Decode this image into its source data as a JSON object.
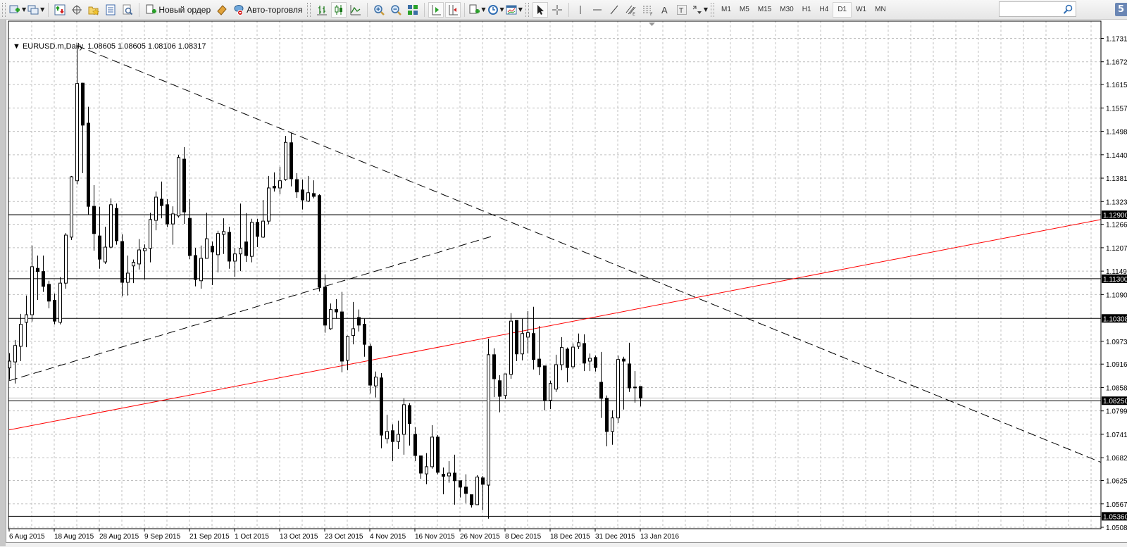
{
  "toolbar": {
    "new_order_label": "Новый ордер",
    "autotrading_label": "Авто-торговля",
    "timeframes": [
      "M1",
      "M5",
      "M15",
      "M30",
      "H1",
      "H4",
      "D1",
      "W1",
      "MN"
    ],
    "active_timeframe": "D1",
    "search_placeholder": "",
    "notification_count": "5"
  },
  "legend": {
    "symbol": "EURUSD.m,Daily",
    "open": "1.08605",
    "high": "1.08605",
    "low": "1.08106",
    "close": "1.08317"
  },
  "colors": {
    "bull_fill": "#ffffff",
    "bear_fill": "#000000",
    "candle_outline": "#000000",
    "grid": "#c0c0c0",
    "trendline_red": "#ff0000",
    "trendline_dashed": "#000000",
    "bid_line": "#c0c0c0"
  },
  "chart_data": {
    "type": "candlestick",
    "symbol": "EURUSD.m",
    "timeframe": "Daily",
    "ylim": [
      1.05085,
      1.1731
    ],
    "price_ticks": [
      "1.17310",
      "1.16725",
      "1.16155",
      "1.15570",
      "1.14985",
      "1.14400",
      "1.13815",
      "1.13230",
      "1.12660",
      "1.12075",
      "1.11490",
      "1.10905",
      "1.09735",
      "1.09165",
      "1.08580",
      "1.07995",
      "1.07410",
      "1.06825",
      "1.06255",
      "1.05670",
      "1.05085"
    ],
    "date_labels": [
      {
        "bar": 0,
        "label": "6 Aug 2015"
      },
      {
        "bar": 8,
        "label": "18 Aug 2015"
      },
      {
        "bar": 16,
        "label": "28 Aug 2015"
      },
      {
        "bar": 24,
        "label": "9 Sep 2015"
      },
      {
        "bar": 32,
        "label": "21 Sep 2015"
      },
      {
        "bar": 40,
        "label": "1 Oct 2015"
      },
      {
        "bar": 48,
        "label": "13 Oct 2015"
      },
      {
        "bar": 56,
        "label": "23 Oct 2015"
      },
      {
        "bar": 64,
        "label": "4 Nov 2015"
      },
      {
        "bar": 72,
        "label": "16 Nov 2015"
      },
      {
        "bar": 80,
        "label": "26 Nov 2015"
      },
      {
        "bar": 88,
        "label": "8 Dec 2015"
      },
      {
        "bar": 96,
        "label": "18 Dec 2015"
      },
      {
        "bar": 104,
        "label": "31 Dec 2015"
      },
      {
        "bar": 112,
        "label": "13 Jan 2016"
      }
    ],
    "horizontal_levels": [
      "1.12900",
      "1.11300",
      "1.10308",
      "1.08250",
      "1.05360"
    ],
    "bid": 1.08317,
    "trendlines": [
      {
        "name": "descending-dashed",
        "style": "dashed",
        "color": "#000000",
        "p1": {
          "bar": 12,
          "price": 1.1713
        },
        "p2": {
          "bar": 193.75,
          "price": 1.0671
        }
      },
      {
        "name": "ascending-dashed",
        "style": "dashed",
        "color": "#000000",
        "p1": {
          "bar": 0,
          "price": 1.0875
        },
        "p2": {
          "bar": 85.9,
          "price": 1.1237
        }
      },
      {
        "name": "ascending-red",
        "style": "solid",
        "color": "#ff0000",
        "p1": {
          "bar": 0,
          "price": 1.0752
        },
        "p2": {
          "bar": 193.75,
          "price": 1.1278
        }
      }
    ],
    "ohlc": [
      [
        1.0907,
        1.0944,
        1.0877,
        1.0924
      ],
      [
        1.0922,
        1.0977,
        1.0868,
        1.0963
      ],
      [
        1.0961,
        1.1042,
        1.0924,
        1.1016
      ],
      [
        1.1021,
        1.1088,
        1.0959,
        1.104
      ],
      [
        1.104,
        1.1213,
        1.1023,
        1.116
      ],
      [
        1.1156,
        1.1188,
        1.1077,
        1.1148
      ],
      [
        1.1148,
        1.1188,
        1.1097,
        1.1111
      ],
      [
        1.1116,
        1.1125,
        1.1056,
        1.1074
      ],
      [
        1.1076,
        1.1093,
        1.1016,
        1.1024
      ],
      [
        1.1021,
        1.1134,
        1.1016,
        1.1119
      ],
      [
        1.1119,
        1.1244,
        1.1105,
        1.1239
      ],
      [
        1.1234,
        1.1387,
        1.1227,
        1.1385
      ],
      [
        1.1375,
        1.1713,
        1.1366,
        1.1618
      ],
      [
        1.1619,
        1.162,
        1.1394,
        1.1514
      ],
      [
        1.1519,
        1.156,
        1.129,
        1.1311
      ],
      [
        1.1311,
        1.1364,
        1.12,
        1.1243
      ],
      [
        1.1237,
        1.131,
        1.1155,
        1.1179
      ],
      [
        1.1172,
        1.126,
        1.1167,
        1.1209
      ],
      [
        1.1209,
        1.1331,
        1.1206,
        1.1315
      ],
      [
        1.1306,
        1.1318,
        1.1215,
        1.1225
      ],
      [
        1.1223,
        1.1241,
        1.1086,
        1.1121
      ],
      [
        1.1121,
        1.1188,
        1.1088,
        1.1144
      ],
      [
        1.1162,
        1.1178,
        1.1119,
        1.1171
      ],
      [
        1.1167,
        1.1229,
        1.1153,
        1.1202
      ],
      [
        1.12,
        1.1216,
        1.1128,
        1.1206
      ],
      [
        1.1206,
        1.1295,
        1.1171,
        1.1278
      ],
      [
        1.1276,
        1.1348,
        1.1251,
        1.1334
      ],
      [
        1.1329,
        1.1373,
        1.1281,
        1.1313
      ],
      [
        1.1315,
        1.1329,
        1.1259,
        1.1267
      ],
      [
        1.1267,
        1.1311,
        1.1215,
        1.1292
      ],
      [
        1.1287,
        1.144,
        1.1283,
        1.1433
      ],
      [
        1.1429,
        1.1459,
        1.1267,
        1.1297
      ],
      [
        1.1281,
        1.1329,
        1.1179,
        1.1188
      ],
      [
        1.1188,
        1.1207,
        1.1111,
        1.1128
      ],
      [
        1.1125,
        1.1213,
        1.1105,
        1.1181
      ],
      [
        1.1181,
        1.1295,
        1.1181,
        1.123
      ],
      [
        1.1211,
        1.1223,
        1.1114,
        1.1197
      ],
      [
        1.119,
        1.125,
        1.1146,
        1.1243
      ],
      [
        1.1241,
        1.1281,
        1.1192,
        1.1248
      ],
      [
        1.1246,
        1.126,
        1.1155,
        1.1174
      ],
      [
        1.1174,
        1.1207,
        1.1135,
        1.1192
      ],
      [
        1.1192,
        1.1318,
        1.1149,
        1.1206
      ],
      [
        1.1222,
        1.1294,
        1.1172,
        1.1188
      ],
      [
        1.1186,
        1.128,
        1.1171,
        1.1271
      ],
      [
        1.1271,
        1.128,
        1.1209,
        1.1236
      ],
      [
        1.1234,
        1.1327,
        1.1232,
        1.1274
      ],
      [
        1.1274,
        1.1387,
        1.1266,
        1.1357
      ],
      [
        1.1361,
        1.1396,
        1.1348,
        1.1357
      ],
      [
        1.1357,
        1.141,
        1.1341,
        1.1375
      ],
      [
        1.1378,
        1.1487,
        1.1375,
        1.1471
      ],
      [
        1.147,
        1.1494,
        1.1361,
        1.138
      ],
      [
        1.1378,
        1.1394,
        1.1332,
        1.1347
      ],
      [
        1.1352,
        1.1378,
        1.1303,
        1.1327
      ],
      [
        1.1324,
        1.1387,
        1.1322,
        1.1345
      ],
      [
        1.1343,
        1.1376,
        1.1331,
        1.1336
      ],
      [
        1.1338,
        1.1341,
        1.1098,
        1.1109
      ],
      [
        1.1109,
        1.1141,
        1.0995,
        1.1014
      ],
      [
        1.1005,
        1.1068,
        1.1002,
        1.1053
      ],
      [
        1.1053,
        1.1079,
        1.103,
        1.1047
      ],
      [
        1.1047,
        1.1097,
        1.0896,
        1.0924
      ],
      [
        1.0926,
        1.0988,
        1.0901,
        1.0986
      ],
      [
        1.0988,
        1.1072,
        1.0966,
        1.1005
      ],
      [
        1.1033,
        1.1053,
        1.0998,
        1.1014
      ],
      [
        1.1016,
        1.103,
        1.0935,
        1.0966
      ],
      [
        1.0961,
        1.0968,
        1.0843,
        1.0864
      ],
      [
        1.0862,
        1.0898,
        1.0833,
        1.0884
      ],
      [
        1.0882,
        1.0894,
        1.0706,
        1.0739
      ],
      [
        1.073,
        1.079,
        1.0718,
        1.0748
      ],
      [
        1.075,
        1.0766,
        1.0674,
        1.0723
      ],
      [
        1.0723,
        1.0775,
        1.0704,
        1.0741
      ],
      [
        1.0741,
        1.0831,
        1.069,
        1.0815
      ],
      [
        1.0813,
        1.0819,
        1.0713,
        1.0768
      ],
      [
        1.0741,
        1.0759,
        1.0674,
        1.0688
      ],
      [
        1.0687,
        1.0687,
        1.063,
        1.0644
      ],
      [
        1.0642,
        1.0694,
        1.0616,
        1.066
      ],
      [
        1.066,
        1.0764,
        1.0655,
        1.0734
      ],
      [
        1.0734,
        1.0739,
        1.0641,
        1.0646
      ],
      [
        1.0641,
        1.0658,
        1.0591,
        1.0636
      ],
      [
        1.0637,
        1.0674,
        1.062,
        1.0644
      ],
      [
        1.0644,
        1.069,
        1.0565,
        1.0625
      ],
      [
        1.0625,
        1.0625,
        1.0583,
        1.0609
      ],
      [
        1.0609,
        1.0641,
        1.0569,
        1.0593
      ],
      [
        1.059,
        1.059,
        1.0558,
        1.0565
      ],
      [
        1.0565,
        1.0639,
        1.0565,
        1.0634
      ],
      [
        1.0632,
        1.0637,
        1.0551,
        1.0616
      ],
      [
        1.0614,
        1.098,
        1.053,
        1.094
      ],
      [
        1.094,
        1.0956,
        1.0834,
        1.088
      ],
      [
        1.0875,
        1.0889,
        1.0796,
        1.0836
      ],
      [
        1.0838,
        1.0892,
        1.0829,
        1.0892
      ],
      [
        1.0891,
        1.1044,
        1.088,
        1.1024
      ],
      [
        1.1026,
        1.1026,
        1.0924,
        1.0942
      ],
      [
        1.0942,
        1.103,
        1.0926,
        1.0993
      ],
      [
        1.0984,
        1.1049,
        1.0943,
        1.0995
      ],
      [
        1.0993,
        1.106,
        1.0903,
        1.0928
      ],
      [
        1.0929,
        1.1012,
        1.0889,
        1.091
      ],
      [
        1.0912,
        1.0912,
        1.0801,
        1.0826
      ],
      [
        1.0826,
        1.0875,
        1.0804,
        1.0868
      ],
      [
        1.0854,
        1.094,
        1.0847,
        1.0915
      ],
      [
        1.0915,
        1.0984,
        1.0901,
        1.0958
      ],
      [
        1.0954,
        1.0958,
        1.0871,
        1.0908
      ],
      [
        1.091,
        1.0968,
        1.0905,
        1.0959
      ],
      [
        1.0961,
        1.0993,
        1.0954,
        1.097
      ],
      [
        1.0968,
        1.0991,
        1.0899,
        1.0919
      ],
      [
        1.0924,
        1.0943,
        1.0899,
        1.0931
      ],
      [
        1.0933,
        1.0938,
        1.0898,
        1.0908
      ],
      [
        1.0871,
        1.0947,
        1.0782,
        1.0831
      ],
      [
        1.0831,
        1.0838,
        1.0711,
        1.0748
      ],
      [
        1.0748,
        1.0801,
        1.0715,
        1.0782
      ],
      [
        1.0782,
        1.0938,
        1.0769,
        1.0928
      ],
      [
        1.0929,
        1.0935,
        1.0803,
        1.0924
      ],
      [
        1.0917,
        1.097,
        1.0847,
        1.0857
      ],
      [
        1.0859,
        1.0899,
        1.082,
        1.0859
      ],
      [
        1.08605,
        1.08605,
        1.08106,
        1.08317
      ]
    ]
  }
}
